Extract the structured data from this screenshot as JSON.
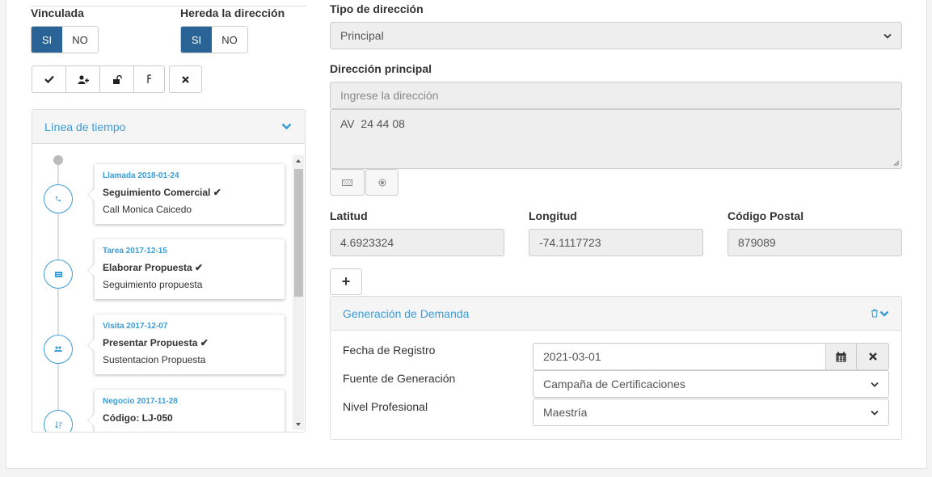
{
  "left": {
    "vinculada_label": "Vinculada",
    "hereda_label": "Hereda la dirección",
    "si": "SI",
    "no": "NO",
    "toolbar_icons": [
      "check-icon",
      "user-plus-icon",
      "unlock-icon",
      "gender-icon",
      "close-icon"
    ]
  },
  "timeline": {
    "title": "Línea de tiempo",
    "items": [
      {
        "head": "Llamada 2018-01-24",
        "title": "Seguimiento Comercial",
        "desc": "Call Monica Caicedo",
        "icon": "phone-icon"
      },
      {
        "head": "Tarea 2017-12-15",
        "title": "Elaborar Propuesta",
        "desc": "Seguimiento propuesta",
        "icon": "task-icon"
      },
      {
        "head": "Visita 2017-12-07",
        "title": "Presentar Propuesta",
        "desc": "Sustentacion Propuesta",
        "icon": "users-icon"
      },
      {
        "head": "Negocio 2017-11-28",
        "title": "Código: LJ-050",
        "desc": "",
        "icon": "sort-icon"
      }
    ],
    "check": "✔"
  },
  "address": {
    "tipo_label": "Tipo de dirección",
    "tipo_value": "Principal",
    "principal_label": "Dirección principal",
    "principal_placeholder": "Ingrese la dirección",
    "principal_value": "AV  24 44 08",
    "latitud_label": "Latitud",
    "latitud_value": "4.6923324",
    "longitud_label": "Longitud",
    "longitud_value": "-74.1117723",
    "postal_label": "Código Postal",
    "postal_value": "879089",
    "add_label": "+"
  },
  "demanda": {
    "title": "Generación de Demanda",
    "fecha_label": "Fecha de Registro",
    "fecha_value": "2021-03-01",
    "fuente_label": "Fuente de Generación",
    "fuente_value": "Campaña de Certificaciones",
    "nivel_label": "Nivel Profesional",
    "nivel_value": "Maestría"
  },
  "colors": {
    "accent": "#3c9cd6",
    "toggle_on": "#2a6496"
  }
}
